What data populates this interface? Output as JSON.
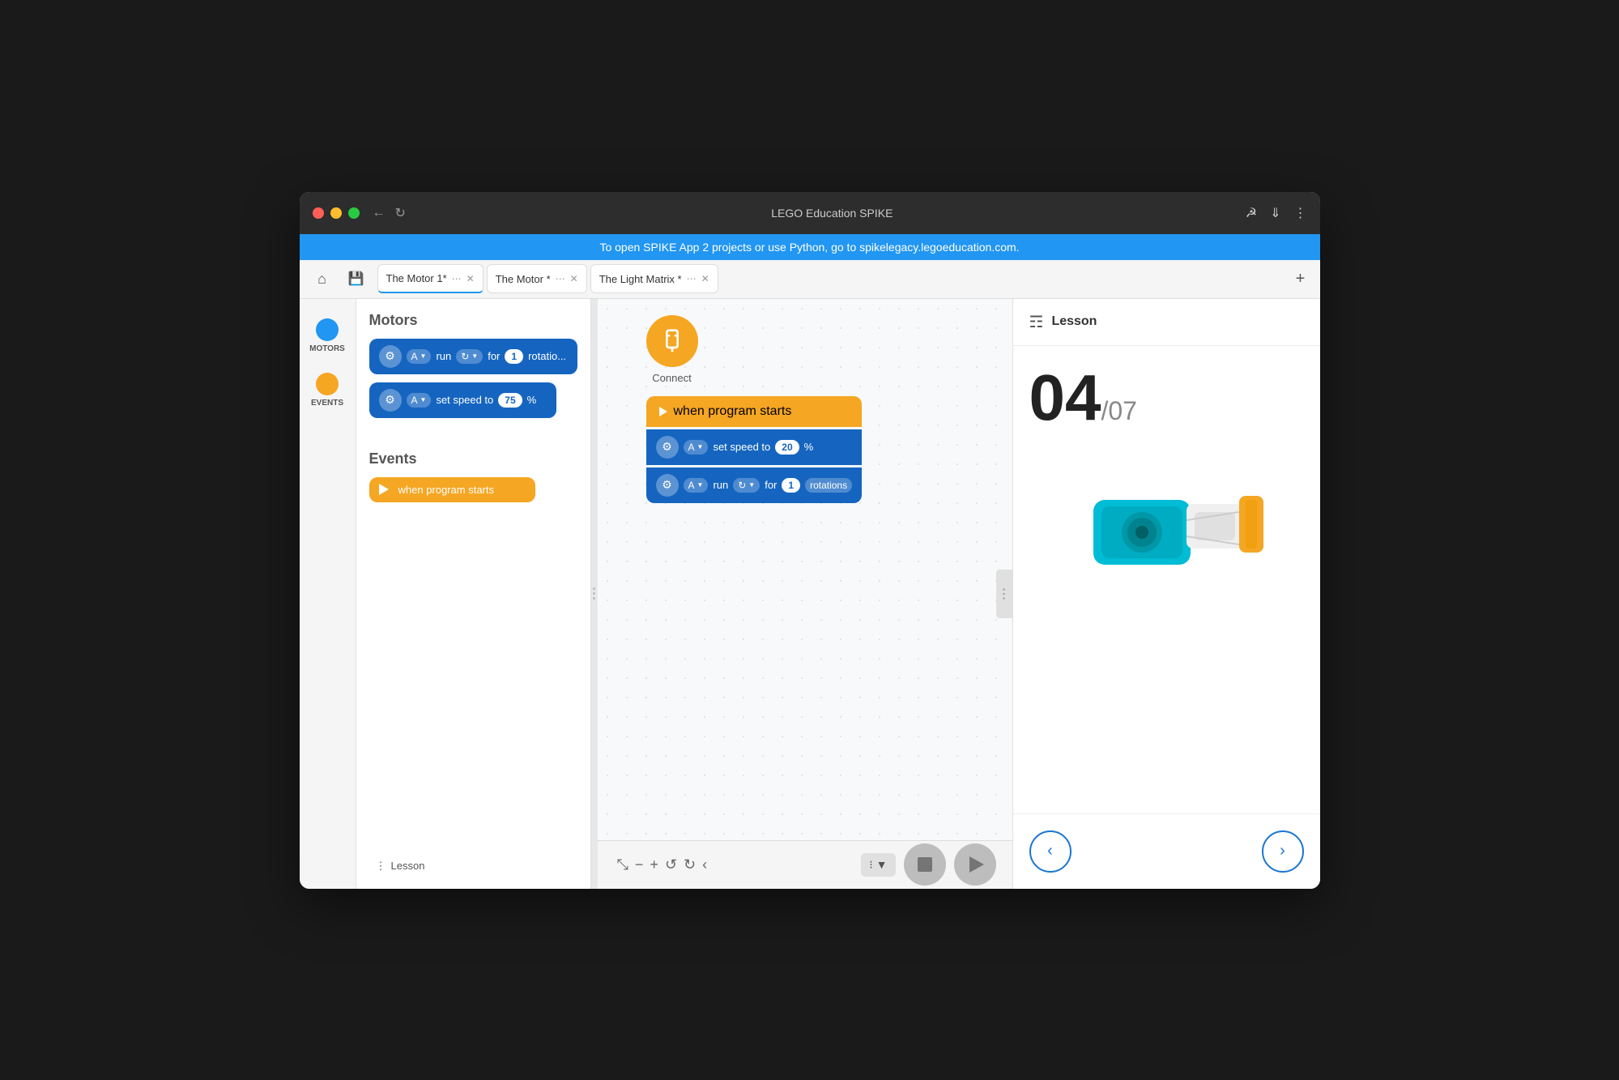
{
  "window": {
    "title": "LEGO Education SPIKE"
  },
  "banner": {
    "text": "To open SPIKE App 2 projects or use Python, go to spikelegacy.legoeducation.com."
  },
  "tabs": [
    {
      "label": "The Motor 1*",
      "active": true
    },
    {
      "label": "The Motor *",
      "active": false
    },
    {
      "label": "The Light Matrix *",
      "active": false
    }
  ],
  "sidebar": {
    "items": [
      {
        "label": "MOTORS",
        "color": "#2196f3"
      },
      {
        "label": "EVENTS",
        "color": "#f5a623"
      }
    ]
  },
  "motorsSection": {
    "title": "Motors",
    "block1": {
      "motor": "A",
      "action": "run",
      "for": "for",
      "value": "1",
      "unit": "rotatio..."
    },
    "block2": {
      "motor": "A",
      "action": "set speed to",
      "value": "75",
      "unit": "%"
    }
  },
  "eventsSection": {
    "title": "Events",
    "block1": {
      "label": "when program starts"
    }
  },
  "connect": {
    "label": "Connect"
  },
  "canvasProgram": {
    "whenBlock": "when program starts",
    "block1": {
      "motor": "A",
      "action": "set speed to",
      "value": "20",
      "unit": "%"
    },
    "block2": {
      "motor": "A",
      "action": "run",
      "for": "for",
      "value": "1",
      "unit": "rotations"
    }
  },
  "lesson": {
    "title": "Lesson",
    "number": "04",
    "total": "/07",
    "prevLabel": "‹",
    "nextLabel": "›"
  },
  "bottomToolbar": {
    "lessonLabel": "Lesson",
    "tools": {
      "collapse": "⤡",
      "zoomOut": "−",
      "zoomIn": "+",
      "undo": "↺",
      "redo": "↻",
      "back": "‹"
    }
  }
}
